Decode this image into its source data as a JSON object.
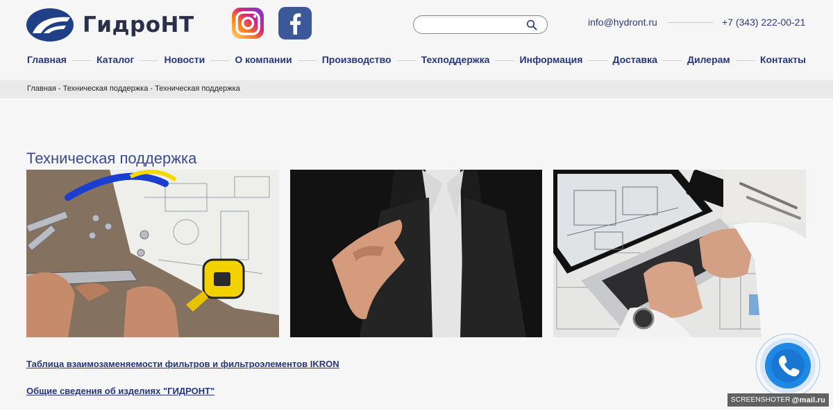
{
  "brand": {
    "name": "ГидроНТ"
  },
  "social": [
    "instagram-icon",
    "facebook-icon"
  ],
  "search": {
    "placeholder": "",
    "value": ""
  },
  "contacts": {
    "email": "info@hydront.ru",
    "phone": "+7 (343) 222-00-21"
  },
  "nav": {
    "items": [
      {
        "label": "Главная"
      },
      {
        "label": "Каталог"
      },
      {
        "label": "Новости"
      },
      {
        "label": "О компании"
      },
      {
        "label": "Производство"
      },
      {
        "label": "Техподдержка"
      },
      {
        "label": "Информация"
      },
      {
        "label": "Доставка"
      },
      {
        "label": "Дилерам"
      },
      {
        "label": "Контакты"
      }
    ]
  },
  "breadcrumb": {
    "items": [
      "Главная",
      "Техническая поддержка",
      "Техническая поддержка"
    ],
    "separator": " - "
  },
  "page": {
    "title": "Техническая поддержка",
    "links": [
      "Таблица взаимозаменяемости фильтров и фильтроэлементов IKRON",
      "Общие сведения об изделиях \"ГИДРОНТ\""
    ]
  },
  "widgets": {
    "call": "phone-icon"
  },
  "watermark": {
    "prefix": "SCREENSHOTER",
    "suffix": "@mail.ru"
  },
  "colors": {
    "accent": "#25367e",
    "call_button": "#1e88e5",
    "facebook": "#3b5998"
  }
}
